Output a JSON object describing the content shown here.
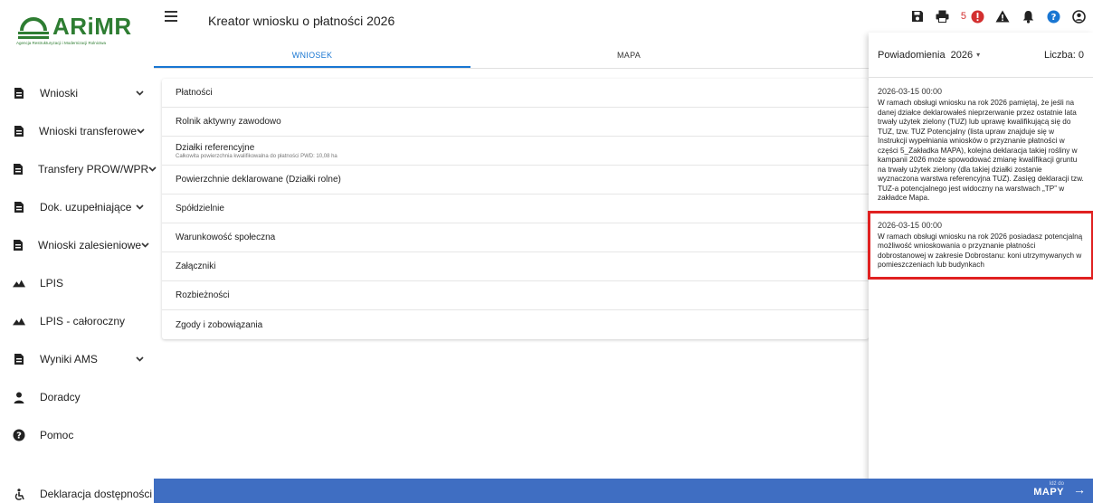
{
  "logo": {
    "name": "ARiMR",
    "subtitle": "Agencja Restrukturyzacji i Modernizacji Rolnictwa"
  },
  "header": {
    "title": "Kreator wniosku o płatności 2026",
    "error_count": "5"
  },
  "tabs": [
    {
      "label": "WNIOSEK",
      "active": true
    },
    {
      "label": "MAPA",
      "active": false
    }
  ],
  "sidebar": {
    "items": [
      {
        "label": "Wnioski",
        "icon": "document-icon",
        "expandable": true
      },
      {
        "label": "Wnioski transferowe",
        "icon": "document-icon",
        "expandable": true
      },
      {
        "label": "Transfery PROW/WPR",
        "icon": "document-icon",
        "expandable": true
      },
      {
        "label": "Dok. uzupełniające",
        "icon": "document-icon",
        "expandable": true
      },
      {
        "label": "Wnioski zalesieniowe",
        "icon": "document-icon",
        "expandable": true
      },
      {
        "label": "LPIS",
        "icon": "mountain-icon",
        "expandable": false
      },
      {
        "label": "LPIS - całoroczny",
        "icon": "mountain-icon",
        "expandable": false
      },
      {
        "label": "Wyniki AMS",
        "icon": "document-icon",
        "expandable": true
      },
      {
        "label": "Doradcy",
        "icon": "person-icon",
        "expandable": false
      },
      {
        "label": "Pomoc",
        "icon": "help-icon",
        "expandable": false
      }
    ],
    "accessibility": "Deklaracja dostępności"
  },
  "sections": [
    {
      "title": "Płatności",
      "sub": ""
    },
    {
      "title": "Rolnik aktywny zawodowo",
      "sub": ""
    },
    {
      "title": "Działki referencyjne",
      "sub": "Całkowita powierzchnia kwalifikowalna do płatności PWD: 10,08 ha"
    },
    {
      "title": "Powierzchnie deklarowane (Działki rolne)",
      "sub": ""
    },
    {
      "title": "Spółdzielnie",
      "sub": ""
    },
    {
      "title": "Warunkowość społeczna",
      "sub": ""
    },
    {
      "title": "Załączniki",
      "sub": ""
    },
    {
      "title": "Rozbieżności",
      "sub": ""
    },
    {
      "title": "Zgody i zobowiązania",
      "sub": ""
    }
  ],
  "notifications": {
    "title": "Powiadomienia",
    "year": "2026",
    "count_label": "Liczba: 0",
    "items": [
      {
        "date": "2026-03-15 00:00",
        "text": "W ramach obsługi wniosku na rok 2026 pamiętaj, że jeśli na danej działce deklarowałeś nieprzerwanie przez ostatnie lata trwały użytek zielony (TUZ) lub uprawę kwalifikującą się do TUZ, tzw. TUZ Potencjalny (lista upraw znajduje się w Instrukcji wypełniania wniosków o przyznanie płatności w części 5_Zakładka MAPA), kolejna deklaracja takiej rośliny w kampanii 2026 może spowodować zmianę kwalifikacji gruntu na trwały użytek zielony (dla takiej działki zostanie wyznaczona warstwa referencyjna TUZ). Zasięg deklaracji tzw. TUZ-a potencjalnego jest widoczny na warstwach „TP” w zakładce Mapa.",
        "highlight": false
      },
      {
        "date": "2026-03-15 00:00",
        "text": "W ramach obsługi wniosku na rok 2026 posiadasz potencjalną możliwość wnioskowania o przyznanie płatności dobrostanowej w zakresie Dobrostanu: koni utrzymywanych w pomieszczeniach lub budynkach",
        "highlight": true
      }
    ]
  },
  "footer": {
    "goto_small": "Idź do",
    "goto_big": "MAPY"
  },
  "colors": {
    "accent": "#1976d2",
    "bottombar": "#3f6ec2",
    "logo": "#2e7d32",
    "highlight": "#e02020",
    "error": "#d32f2f"
  }
}
